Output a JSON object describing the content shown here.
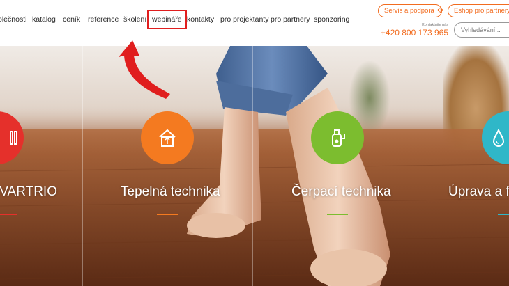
{
  "nav": {
    "items": [
      "olečnosti",
      "katalog",
      "ceník",
      "reference",
      "školení",
      "webináře",
      "kontakty",
      "pro projektanty",
      "pro partnery",
      "sponzoring"
    ],
    "active": "webináře"
  },
  "header": {
    "service_label": "Servis a podpora",
    "eshop_label": "Eshop pro partnery",
    "contact_label": "Kontaktujte nás",
    "phone": "+420 800 173 965",
    "search_placeholder": "Vyhledávání..."
  },
  "hero": {
    "cards": [
      {
        "title": "IVARTRIO",
        "color": "#e5302b",
        "icon": "radiator-icon"
      },
      {
        "title": "Tepelná technika",
        "color": "#f47a20",
        "icon": "house-heating-icon"
      },
      {
        "title": "Čerpací technika",
        "color": "#7cbd2f",
        "icon": "pump-icon"
      },
      {
        "title": "Úprava a fi",
        "color": "#2fb7c8",
        "icon": "water-drop-icon"
      }
    ]
  },
  "annotation": {
    "color": "#e01e1e",
    "icon": "curved-arrow-icon"
  }
}
